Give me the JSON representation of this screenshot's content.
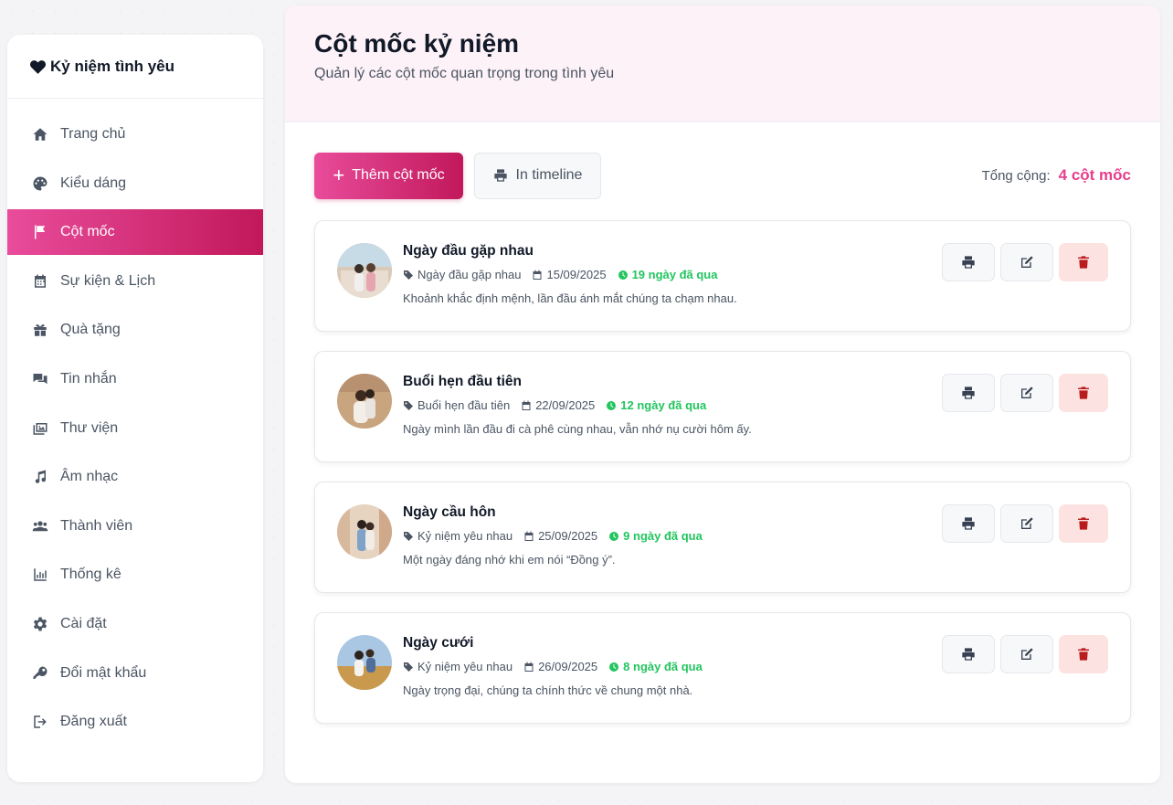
{
  "sidebar": {
    "brand": "Kỷ niệm tình yêu",
    "items": [
      {
        "label": "Trang chủ",
        "icon": "home-icon"
      },
      {
        "label": "Kiểu dáng",
        "icon": "palette-icon"
      },
      {
        "label": "Cột mốc",
        "icon": "flag-icon",
        "active": true
      },
      {
        "label": "Sự kiện & Lịch",
        "icon": "calendar-icon"
      },
      {
        "label": "Quà tặng",
        "icon": "gift-icon"
      },
      {
        "label": "Tin nhắn",
        "icon": "chat-icon"
      },
      {
        "label": "Thư viện",
        "icon": "gallery-icon"
      },
      {
        "label": "Âm nhạc",
        "icon": "music-icon"
      },
      {
        "label": "Thành viên",
        "icon": "users-icon"
      },
      {
        "label": "Thống kê",
        "icon": "chart-icon"
      },
      {
        "label": "Cài đặt",
        "icon": "gear-icon"
      },
      {
        "label": "Đổi mật khẩu",
        "icon": "key-icon"
      },
      {
        "label": "Đăng xuất",
        "icon": "logout-icon"
      }
    ]
  },
  "header": {
    "title": "Cột mốc kỷ niệm",
    "subtitle": "Quản lý các cột mốc quan trọng trong tình yêu"
  },
  "toolbar": {
    "add_label": "Thêm cột mốc",
    "print_label": "In timeline",
    "total_label": "Tổng cộng:",
    "total_value": "4 cột mốc"
  },
  "milestones": [
    {
      "title": "Ngày đầu gặp nhau",
      "category": "Ngày đầu gặp nhau",
      "date": "15/09/2025",
      "ago": "19 ngày đã qua",
      "description": "Khoảnh khắc định mệnh, lần đầu ánh mắt chúng ta chạm nhau."
    },
    {
      "title": "Buổi hẹn đầu tiên",
      "category": "Buổi hẹn đầu tiên",
      "date": "22/09/2025",
      "ago": "12 ngày đã qua",
      "description": "Ngày mình lần đầu đi cà phê cùng nhau, vẫn nhớ nụ cười hôm ấy."
    },
    {
      "title": "Ngày cầu hôn",
      "category": "Kỷ niệm yêu nhau",
      "date": "25/09/2025",
      "ago": "9 ngày đã qua",
      "description": "Một ngày đáng nhớ khi em nói “Đồng ý”."
    },
    {
      "title": "Ngày cưới",
      "category": "Kỷ niệm yêu nhau",
      "date": "26/09/2025",
      "ago": "8 ngày đã qua",
      "description": "Ngày trọng đại, chúng ta chính thức về chung một nhà."
    }
  ],
  "colors": {
    "accent": "#e83e8c",
    "accent_dark": "#c2185b",
    "success": "#22c55e",
    "danger_bg": "#fde2e2",
    "danger": "#b91c1c"
  }
}
